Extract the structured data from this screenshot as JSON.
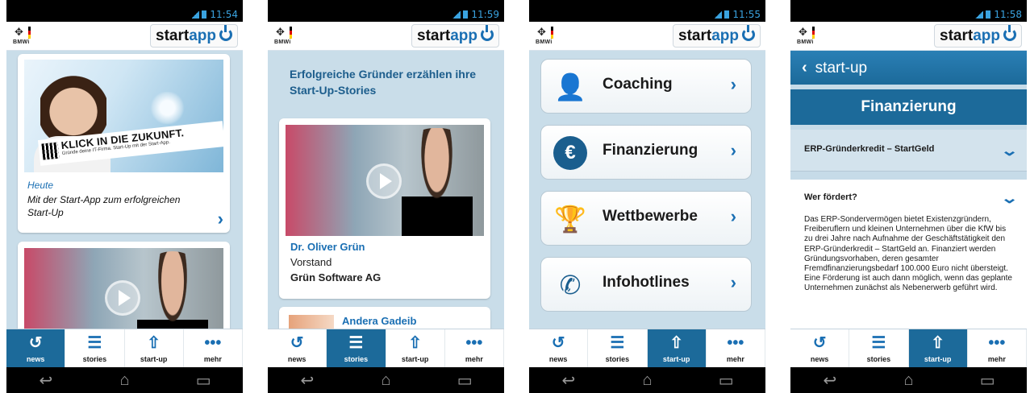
{
  "header": {
    "bmwi_label": "BMWi",
    "logo_start": "start",
    "logo_app": "app"
  },
  "tabs": [
    {
      "label": "news",
      "icon": "history-icon"
    },
    {
      "label": "stories",
      "icon": "document-icon"
    },
    {
      "label": "start-up",
      "icon": "upload-icon"
    },
    {
      "label": "mehr",
      "icon": "more-icon"
    }
  ],
  "phones": [
    {
      "time": "11:54",
      "active_tab": "news",
      "promo": {
        "headline": "KLICK IN DIE ZUKUNFT.",
        "subline": "Gründe deine IT-Firma. Start-Up mit der Start-App."
      },
      "news": {
        "date": "Heute",
        "title": "Mit der Start-App zum erfolgreichen Start-Up"
      }
    },
    {
      "time": "11:59",
      "active_tab": "stories",
      "intro": "Erfolgreiche Gründer erzählen ihre Start-Up-Stories",
      "story": {
        "name": "Dr. Oliver Grün",
        "role": "Vorstand",
        "company": "Grün Software AG"
      },
      "next_story": {
        "name": "Andera Gadeib"
      }
    },
    {
      "time": "11:55",
      "active_tab": "start-up",
      "menu": [
        {
          "label": "Coaching",
          "icon": "person-icon"
        },
        {
          "label": "Finanzierung",
          "icon": "euro-icon"
        },
        {
          "label": "Wettbewerbe",
          "icon": "trophy-icon"
        },
        {
          "label": "Infohotlines",
          "icon": "phone-icon"
        }
      ]
    },
    {
      "time": "11:58",
      "active_tab": "start-up",
      "back_title": "start-up",
      "section": "Finanzierung",
      "accordion_title": "ERP-Gründerkredit – StartGeld",
      "question": "Wer fördert?",
      "answer": "Das ERP-Sondervermögen bietet Existenzgründern, Freiberuflern und kleinen Unternehmen über die KfW bis zu drei Jahre nach Aufnahme der Geschäftstätigkeit den ERP-Gründerkredit – StartGeld an. Finanziert werden Gründungsvorhaben, deren gesamter Fremdfinanzierungsbedarf 100.000 Euro nicht übersteigt. Eine Förderung ist auch dann möglich, wenn das geplante Unternehmen zunächst als Nebenerwerb geführt wird."
    }
  ],
  "colors": {
    "accent": "#1a6fb3",
    "active_tab": "#1c6a9a",
    "content_bg": "#c9dde9"
  }
}
